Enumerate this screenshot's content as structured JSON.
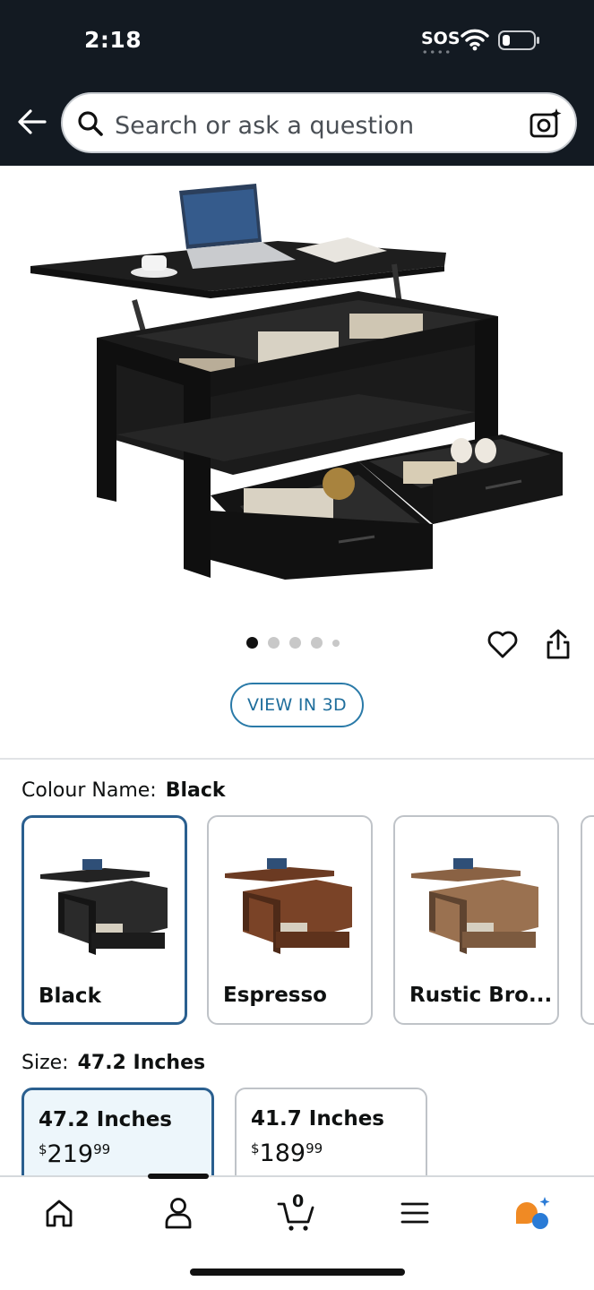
{
  "status_bar": {
    "time": "2:18",
    "sos": "SOS"
  },
  "search": {
    "placeholder": "Search or ask a question"
  },
  "gallery": {
    "page_count": 5,
    "active_index": 0
  },
  "actions": {
    "view_3d": "VIEW IN 3D"
  },
  "colour": {
    "label": "Colour Name:",
    "selected": "Black",
    "options": [
      {
        "name": "Black",
        "selected": true,
        "color": "#232323"
      },
      {
        "name": "Espresso",
        "selected": false,
        "color": "#6b3a22"
      },
      {
        "name": "Rustic Bro...",
        "selected": false,
        "color": "#8a6244"
      }
    ]
  },
  "size": {
    "label": "Size:",
    "selected": "47.2 Inches",
    "options": [
      {
        "name": "47.2 Inches",
        "currency": "$",
        "whole": "219",
        "cents": "99",
        "selected": true
      },
      {
        "name": "41.7 Inches",
        "currency": "$",
        "whole": "189",
        "cents": "99",
        "selected": false
      }
    ]
  },
  "bottom_nav": {
    "cart_count": "0"
  },
  "colors": {
    "header": "#131a22",
    "selected_border": "#2a5f8f",
    "link_blue": "#1f6e9c",
    "rufus_orange": "#f08a24",
    "rufus_blue": "#2a7bd6"
  }
}
